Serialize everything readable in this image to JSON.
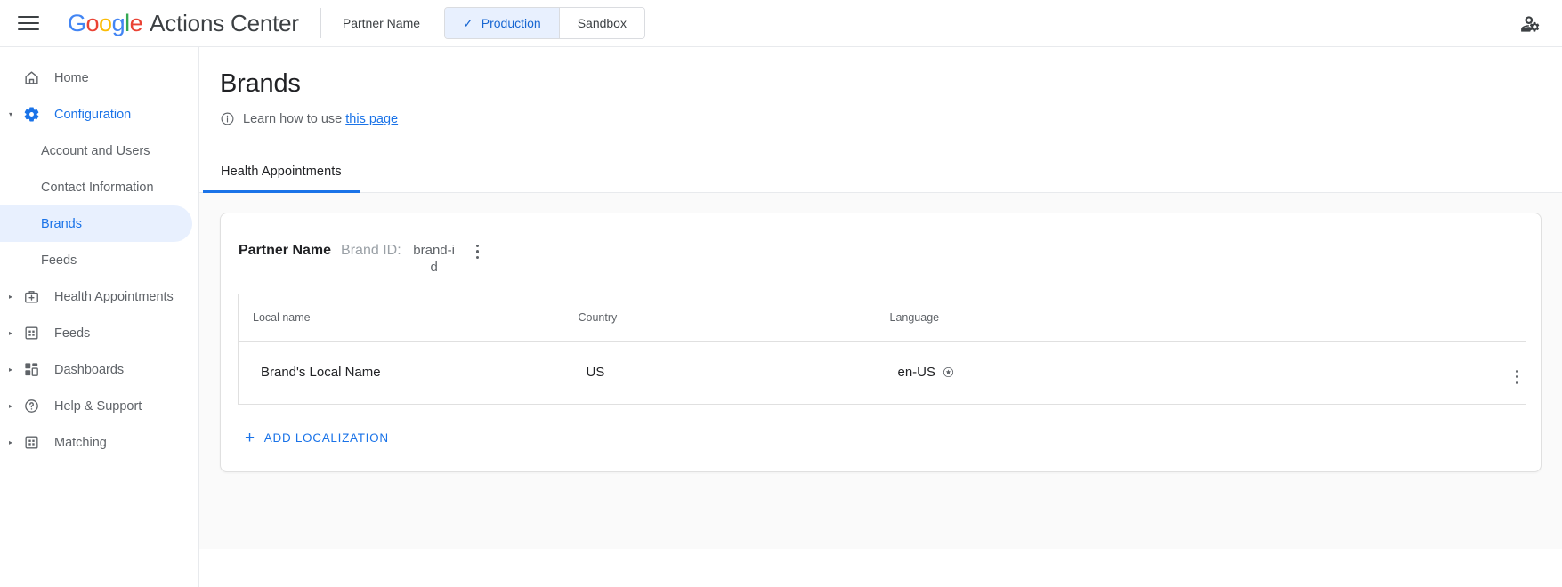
{
  "topbar": {
    "menu_icon": "hamburger-menu-icon",
    "logo_letters": [
      "G",
      "o",
      "o",
      "g",
      "l",
      "e"
    ],
    "product_name": "Actions Center",
    "partner_name": "Partner Name",
    "env_tabs": [
      {
        "label": "Production",
        "active": true,
        "check": "✓"
      },
      {
        "label": "Sandbox",
        "active": false
      }
    ],
    "account_icon": "account-manage-icon"
  },
  "sidebar": {
    "items": [
      {
        "label": "Home",
        "icon": "home-icon",
        "expandable": false,
        "selected": false
      },
      {
        "label": "Configuration",
        "icon": "gear-icon",
        "expandable": true,
        "expanded": true,
        "selected": true
      },
      {
        "label": "Health Appointments",
        "icon": "medical-bag-icon",
        "expandable": true,
        "selected": false
      },
      {
        "label": "Feeds",
        "icon": "grid-feed-icon",
        "expandable": true,
        "selected": false
      },
      {
        "label": "Dashboards",
        "icon": "dashboard-icon",
        "expandable": true,
        "selected": false
      },
      {
        "label": "Help & Support",
        "icon": "help-circle-icon",
        "expandable": true,
        "selected": false
      },
      {
        "label": "Matching",
        "icon": "matching-grid-icon",
        "expandable": true,
        "selected": false
      }
    ],
    "sub_items": [
      {
        "label": "Account and Users",
        "active": false
      },
      {
        "label": "Contact Information",
        "active": false
      },
      {
        "label": "Brands",
        "active": true
      },
      {
        "label": "Feeds",
        "active": false
      }
    ]
  },
  "main": {
    "page_title": "Brands",
    "learn_text": "Learn how to use",
    "learn_link": "this page",
    "info_icon": "info-circle-icon",
    "tabs": [
      {
        "label": "Health Appointments",
        "active": true
      }
    ]
  },
  "brand_card": {
    "brand_name": "Partner Name",
    "brand_id_label": "Brand ID:",
    "brand_id_value": "brand-id",
    "menu_icon": "more-vert-icon",
    "table": {
      "columns": [
        "Local name",
        "Country",
        "Language",
        ""
      ],
      "rows": [
        {
          "local_name": "Brand's Local Name",
          "country": "US",
          "language": "en-US",
          "default_icon": "default-star-icon",
          "row_menu_icon": "more-vert-icon"
        }
      ]
    },
    "add_localization_label": "ADD LOCALIZATION",
    "add_icon": "plus-icon"
  },
  "colors": {
    "accent_blue": "#1a73e8",
    "accent_blue_dark": "#1967d2",
    "selected_bg": "#e8f0fe",
    "text_primary": "#202124",
    "text_secondary": "#5f6368",
    "border": "#e0e0e0",
    "content_bg": "#fafafa"
  }
}
